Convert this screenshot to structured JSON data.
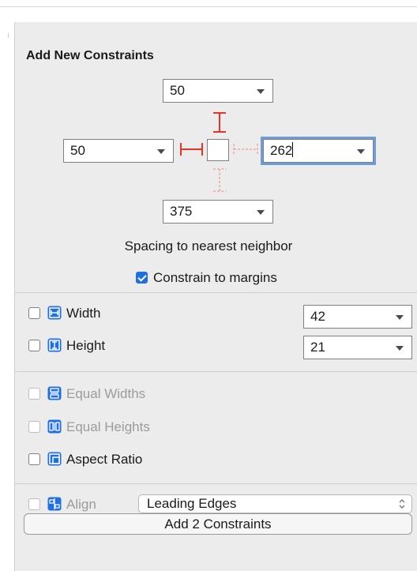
{
  "panel": {
    "title": "Add New Constraints"
  },
  "spacing": {
    "top": "50",
    "left": "50",
    "right": "262",
    "bottom": "375",
    "caption": "Spacing to nearest neighbor"
  },
  "margins": {
    "label": "Constrain to margins",
    "checked": true
  },
  "dimensions": {
    "width": {
      "label": "Width",
      "value": "42",
      "checked": false
    },
    "height": {
      "label": "Height",
      "value": "21",
      "checked": false
    }
  },
  "equal": {
    "widths_label": "Equal Widths",
    "heights_label": "Equal Heights"
  },
  "aspect": {
    "label": "Aspect Ratio",
    "checked": false
  },
  "align": {
    "label": "Align",
    "value": "Leading Edges"
  },
  "action": {
    "button_label": "Add 2 Constraints"
  },
  "colors": {
    "accent": "#1f6fe0",
    "constraint_red": "#e5332a",
    "panel_bg": "#ececec"
  }
}
